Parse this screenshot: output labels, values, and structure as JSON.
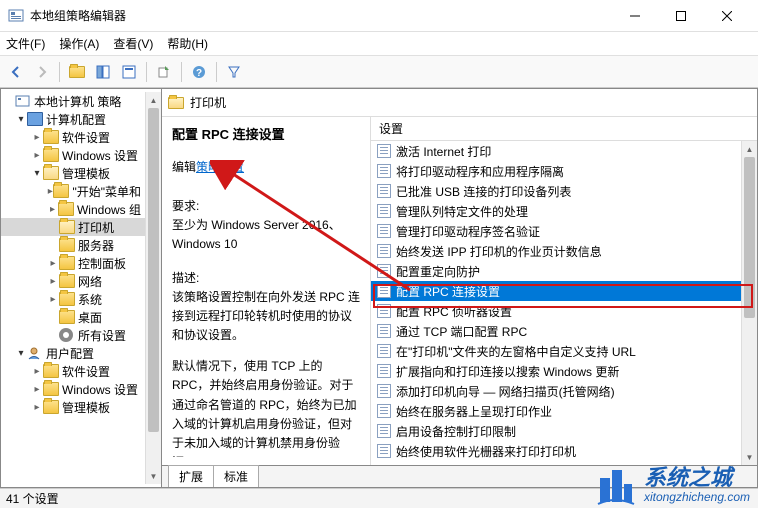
{
  "window": {
    "title": "本地组策略编辑器"
  },
  "menu": {
    "file": "文件(F)",
    "action": "操作(A)",
    "view": "查看(V)",
    "help": "帮助(H)"
  },
  "tree": {
    "root": "本地计算机 策略",
    "computer": "计算机配置",
    "software1": "软件设置",
    "windows1": "Windows 设置",
    "admin1": "管理模板",
    "start": "\"开始\"菜单和",
    "wincomp": "Windows 组",
    "printers": "打印机",
    "servers": "服务器",
    "control": "控制面板",
    "network": "网络",
    "system": "系统",
    "desktop": "桌面",
    "all": "所有设置",
    "user": "用户配置",
    "software2": "软件设置",
    "windows2": "Windows 设置",
    "admin2": "管理模板"
  },
  "header": {
    "title": "打印机"
  },
  "details": {
    "title": "配置 RPC 连接设置",
    "edit_prefix": "编辑",
    "edit_link": "策略设置",
    "req_label": "要求:",
    "req_text": "至少为 Windows Server 2016、Windows 10",
    "desc_label": "描述:",
    "desc_p1": "该策略设置控制在向外发送 RPC 连接到远程打印轮转机时使用的协议和协议设置。",
    "desc_p2": "默认情况下，使用 TCP 上的 RPC，并始终启用身份验证。对于通过命名管道的 RPC，始终为已加入域的计算机启用身份验证，但对于未加入域的计算机禁用身份验证。"
  },
  "settings": {
    "header": "设置",
    "items": [
      "激活 Internet 打印",
      "将打印驱动程序和应用程序隔离",
      "已批准 USB 连接的打印设备列表",
      "管理队列特定文件的处理",
      "管理打印驱动程序签名验证",
      "始终发送 IPP 打印机的作业页计数信息",
      "配置重定向防护",
      "配置 RPC 连接设置",
      "配置 RPC 侦听器设置",
      "通过 TCP 端口配置 RPC",
      "在\"打印机\"文件夹的左窗格中自定义支持 URL",
      "扩展指向和打印连接以搜索 Windows 更新",
      "添加打印机向导 — 网络扫描页(托管网络)",
      "始终在服务器上呈现打印作业",
      "启用设备控制打印限制",
      "始终使用软件光栅器来打印打印机"
    ],
    "selected_index": 7
  },
  "tabs": {
    "extended": "扩展",
    "standard": "标准"
  },
  "status": {
    "text": "41 个设置"
  },
  "watermark": {
    "cn": "系统之城",
    "url": "xitongzhicheng.com"
  }
}
